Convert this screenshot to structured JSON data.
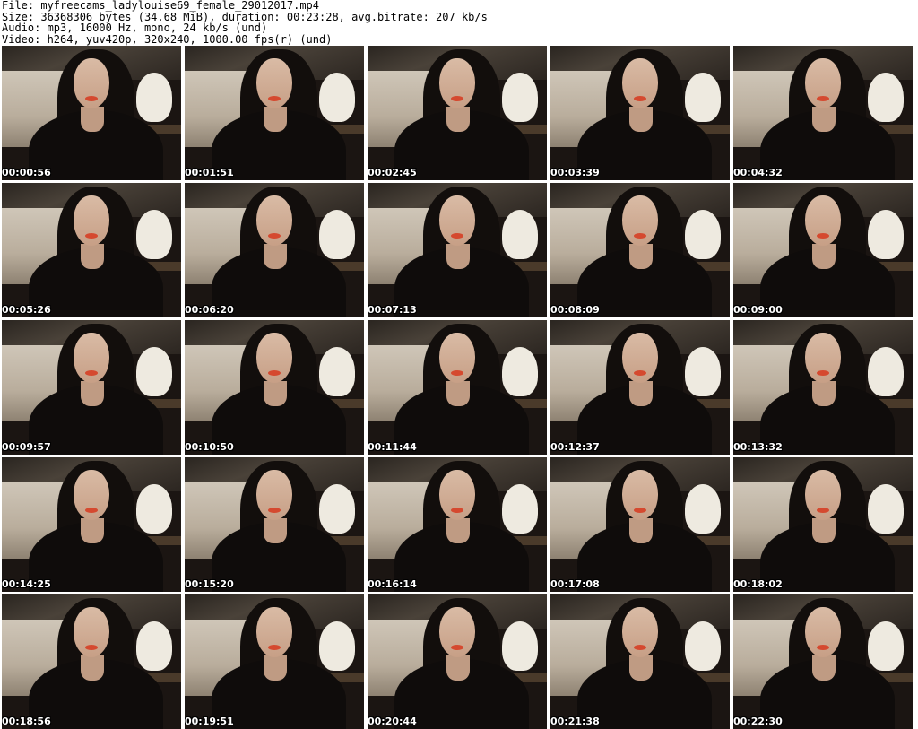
{
  "header": {
    "file_line": "File: myfreecams_ladylouise69_female_29012017.mp4",
    "size_line": "Size: 36368306 bytes (34.68 MiB), duration: 00:23:28, avg.bitrate: 207 kb/s",
    "audio_line": "Audio: mp3, 16000 Hz, mono, 24 kb/s (und)",
    "video_line": "Video: h264, yuv420p, 320x240, 1000.00 fps(r) (und)"
  },
  "thumbnails": [
    {
      "timestamp": "00:00:56"
    },
    {
      "timestamp": "00:01:51"
    },
    {
      "timestamp": "00:02:45"
    },
    {
      "timestamp": "00:03:39"
    },
    {
      "timestamp": "00:04:32"
    },
    {
      "timestamp": "00:05:26"
    },
    {
      "timestamp": "00:06:20"
    },
    {
      "timestamp": "00:07:13"
    },
    {
      "timestamp": "00:08:09"
    },
    {
      "timestamp": "00:09:00"
    },
    {
      "timestamp": "00:09:57"
    },
    {
      "timestamp": "00:10:50"
    },
    {
      "timestamp": "00:11:44"
    },
    {
      "timestamp": "00:12:37"
    },
    {
      "timestamp": "00:13:32"
    },
    {
      "timestamp": "00:14:25"
    },
    {
      "timestamp": "00:15:20"
    },
    {
      "timestamp": "00:16:14"
    },
    {
      "timestamp": "00:17:08"
    },
    {
      "timestamp": "00:18:02"
    },
    {
      "timestamp": "00:18:56"
    },
    {
      "timestamp": "00:19:51"
    },
    {
      "timestamp": "00:20:44"
    },
    {
      "timestamp": "00:21:38"
    },
    {
      "timestamp": "00:22:30"
    }
  ]
}
